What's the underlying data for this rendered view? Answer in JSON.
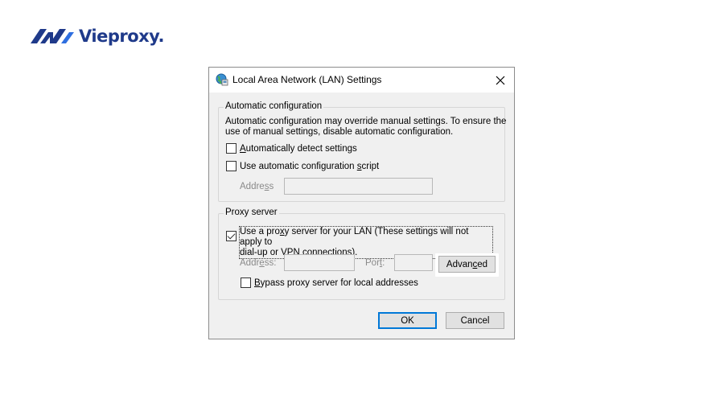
{
  "logo": {
    "text": "Vieproxy."
  },
  "dialog": {
    "title": "Local Area Network (LAN) Settings",
    "auto_config": {
      "group_title": "Automatic configuration",
      "description_line1": "Automatic configuration may override manual settings.  To ensure the",
      "description_line2": "use of manual settings, disable automatic configuration.",
      "detect_pre": "",
      "detect_mnemonic": "A",
      "detect_rest": "utomatically detect settings",
      "detect_checked": false,
      "script_pre": "Use automatic configuration ",
      "script_mnemonic": "s",
      "script_rest": "cript",
      "script_checked": false,
      "address_label_pre": "Addre",
      "address_label_mnemonic": "s",
      "address_label_rest": "s",
      "address_value": ""
    },
    "proxy": {
      "group_title": "Proxy server",
      "use_proxy_line1_pre": "Use a pro",
      "use_proxy_line1_mnemonic": "x",
      "use_proxy_line1_rest": "y server for your LAN (These settings will not apply to",
      "use_proxy_line2": "dial-up or VPN connections).",
      "use_proxy_checked": true,
      "address_label_pre": "Addr",
      "address_label_mnemonic": "e",
      "address_label_rest": "ss:",
      "address_value": "",
      "port_label_pre": "Por",
      "port_label_mnemonic": "t",
      "port_label_rest": ":",
      "port_value": "",
      "advanced_pre": "Advan",
      "advanced_mnemonic": "c",
      "advanced_rest": "ed",
      "bypass_pre": "",
      "bypass_mnemonic": "B",
      "bypass_rest": "ypass proxy server for local addresses",
      "bypass_checked": false
    },
    "ok_label": "OK",
    "cancel_label": "Cancel"
  }
}
